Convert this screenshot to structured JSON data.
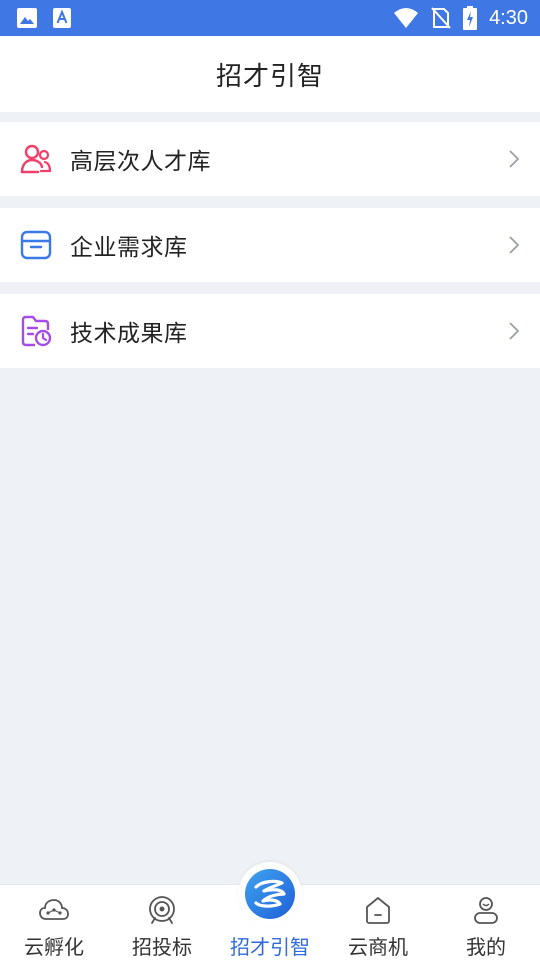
{
  "status_bar": {
    "time": "4:30",
    "left_icons": [
      "image-icon",
      "text-a-icon"
    ],
    "right_icons": [
      "wifi-icon",
      "no-sim-icon",
      "battery-charging-icon"
    ]
  },
  "header": {
    "title": "招才引智"
  },
  "menu": [
    {
      "label": "高层次人才库",
      "icon": "people-icon",
      "color": "#ef3f6a"
    },
    {
      "label": "企业需求库",
      "icon": "archive-box-icon",
      "color": "#3a7ae8"
    },
    {
      "label": "技术成果库",
      "icon": "document-clock-icon",
      "color": "#a44ee6"
    }
  ],
  "bottom_nav": [
    {
      "label": "云孵化",
      "icon": "cloud-nodes-icon",
      "active": false
    },
    {
      "label": "招投标",
      "icon": "target-icon",
      "active": false
    },
    {
      "label": "招才引智",
      "icon": "app-logo-icon",
      "active": true
    },
    {
      "label": "云商机",
      "icon": "home-icon",
      "active": false
    },
    {
      "label": "我的",
      "icon": "user-icon",
      "active": false
    }
  ],
  "colors": {
    "status_bar": "#3f78e4",
    "accent": "#2f6bdc",
    "background": "#eef1f5"
  }
}
